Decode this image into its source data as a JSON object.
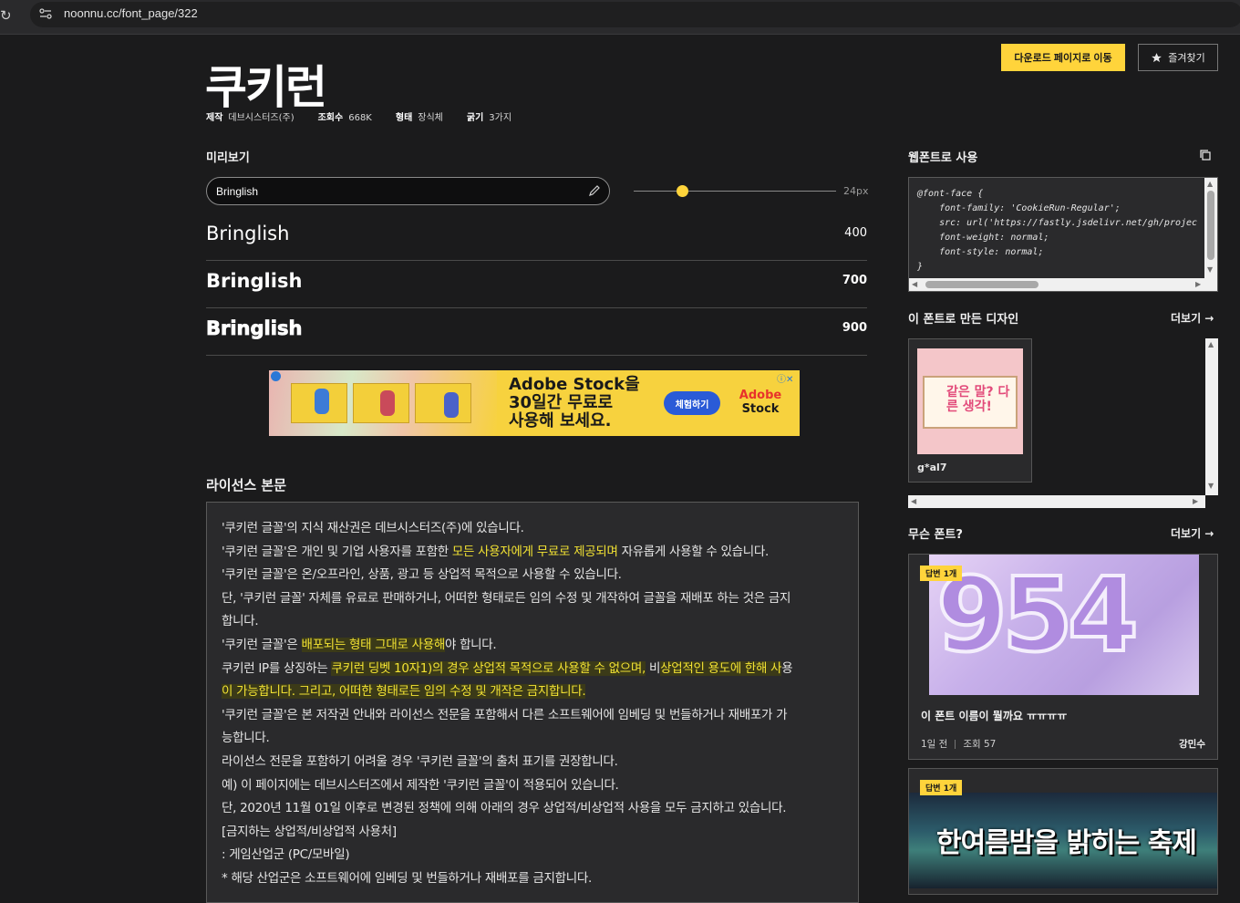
{
  "browser": {
    "url": "noonnu.cc/font_page/322"
  },
  "header": {
    "title": "쿠키런",
    "meta": [
      {
        "key": "제작",
        "value": "데브시스터즈(주)"
      },
      {
        "key": "조회수",
        "value": "668K"
      },
      {
        "key": "형태",
        "value": "장식체"
      },
      {
        "key": "굵기",
        "value": "3가지"
      }
    ],
    "download_label": "다운로드 페이지로 이동",
    "favorite_label": "즐겨찾기"
  },
  "preview": {
    "label": "미리보기",
    "input_value": "Bringlish",
    "size_label": "24px",
    "slider_level": 0.24,
    "samples": [
      {
        "text": "Bringlish",
        "weight": "400"
      },
      {
        "text": "Bringlish",
        "weight": "700"
      },
      {
        "text": "Bringlish",
        "weight": "900"
      }
    ]
  },
  "ad": {
    "headline_1": "Adobe Stock을",
    "headline_2": "30일간 무료로",
    "headline_3": "사용해 보세요.",
    "cta": "체험하기",
    "logo_1": "Adobe",
    "logo_2": "Stock"
  },
  "license": {
    "label": "라이선스 본문",
    "lines": [
      {
        "parts": [
          {
            "t": "'쿠키런 글꼴'의 지식 재산권은 데브시스터즈(주)에 있습니다.",
            "h": 0
          }
        ]
      },
      {
        "parts": [
          {
            "t": "'쿠키런 글꼴'은 개인 및 기업 사용자를 포함한 ",
            "h": 0
          },
          {
            "t": "모든 사용자에게 무료로 제공되며",
            "h": 1
          },
          {
            "t": " 자유롭게 사용할 수 있습니다.",
            "h": 0
          }
        ]
      },
      {
        "parts": [
          {
            "t": "'쿠키런 글꼴'은 온/오프라인, 상품, 광고 등 상업적 목적으로 사용할 수 있습니다.",
            "h": 0
          }
        ]
      },
      {
        "parts": [
          {
            "t": "단, '쿠키런 글꼴' 자체를 유료로 판매하거나, 어떠한 형태로든 임의 수정 및 개작하여 글꼴을 재배포 하는 것은 금지",
            "h": 0
          }
        ]
      },
      {
        "parts": [
          {
            "t": "합니다.",
            "h": 0
          }
        ]
      },
      {
        "parts": [
          {
            "t": "'쿠키런 글꼴'은 ",
            "h": 0
          },
          {
            "t": "배포되는 형태 그대로 사용해",
            "h": 2
          },
          {
            "t": "야 합니다.",
            "h": 0
          }
        ]
      },
      {
        "parts": [
          {
            "t": "쿠키런 IP를 상징하는 ",
            "h": 0
          },
          {
            "t": "쿠키런 딩벳 10자1)의 경우 상업적 목적으로 사용할 수 없으며,",
            "h": 2
          },
          {
            "t": " 비",
            "h": 0
          },
          {
            "t": "상업적인 용도에 한해 사",
            "h": 2
          },
          {
            "t": "용",
            "h": 0
          }
        ]
      },
      {
        "parts": [
          {
            "t": "이 가능합니다. 그리고, 어떠한 형태로든 임의 수정 및 개작은 금지합니다.",
            "h": 2
          }
        ]
      },
      {
        "parts": [
          {
            "t": "'쿠키런 글꼴'은 본 저작권 안내와 라이선스 전문을 포함해서 다른 소프트웨어에 임베딩 및 번들하거나 재배포가 가",
            "h": 0
          }
        ]
      },
      {
        "parts": [
          {
            "t": "능합니다.",
            "h": 0
          }
        ]
      },
      {
        "parts": [
          {
            "t": "라이선스 전문을 포함하기 어려울 경우 '쿠키런 글꼴'의 출처 표기를 권장합니다.",
            "h": 0
          }
        ]
      },
      {
        "parts": [
          {
            "t": "예) 이 페이지에는 데브시스터즈에서 제작한 '쿠키런 글꼴'이 적용되어 있습니다.",
            "h": 0
          }
        ]
      },
      {
        "parts": [
          {
            "t": "단, 2020년 11월 01일 이후로 변경된 정책에 의해 아래의 경우 상업적/비상업적 사용을 모두 금지하고 있습니다.",
            "h": 0
          }
        ]
      },
      {
        "parts": [
          {
            "t": "[금지하는 상업적/비상업적 사용처]",
            "h": 0
          }
        ]
      },
      {
        "parts": [
          {
            "t": ": 게임산업군 (PC/모바일)",
            "h": 0
          }
        ]
      },
      {
        "parts": [
          {
            "t": "* 해당 산업군은 소프트웨어에 임베딩 및 번들하거나 재배포를 금지합니다.",
            "h": 0
          }
        ]
      }
    ]
  },
  "webfont": {
    "label": "웹폰트로 사용",
    "code": "@font-face {\n    font-family: 'CookieRun-Regular';\n    src: url('https://fastly.jsdelivr.net/gh/projec\n    font-weight: normal;\n    font-style: normal;\n}"
  },
  "designs": {
    "label": "이 폰트로 만든 디자인",
    "more": "더보기 →",
    "card_title": "같은 말? 다른 생각!",
    "card_label": "g*al7"
  },
  "qa": {
    "label": "무슨 폰트?",
    "more": "더보기 →",
    "cards": [
      {
        "badge": "답변 1개",
        "image_text": "954",
        "title": "이 폰트 이름이 뭘까요 ㅠㅠㅠㅠ",
        "time": "1일 전",
        "views": "조회 57",
        "author": "강민수"
      },
      {
        "badge": "답변 1개",
        "image_text": "한여름밤을 밝히는 축제"
      }
    ]
  },
  "colors": {
    "accent": "#ffd43b",
    "background": "#1b1b1c",
    "highlight_text": "#f2e233"
  }
}
